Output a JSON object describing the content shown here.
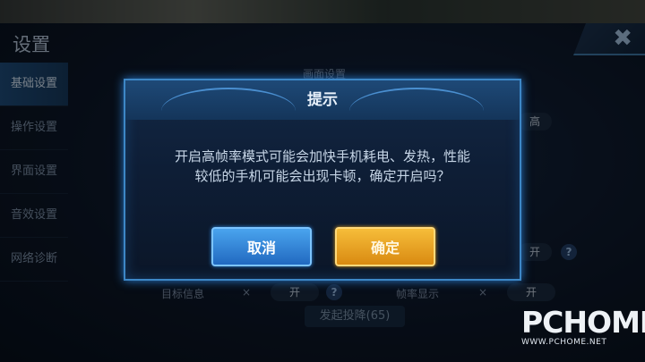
{
  "page": {
    "title": "设置"
  },
  "sidebar": {
    "items": [
      {
        "label": "基础设置",
        "active": true
      },
      {
        "label": "操作设置"
      },
      {
        "label": "界面设置"
      },
      {
        "label": "音效设置"
      },
      {
        "label": "网络诊断"
      }
    ]
  },
  "background": {
    "section_heading": "画面设置",
    "quality_value": "高",
    "toggle_on": "开",
    "toggle_off": "×",
    "help": "?",
    "target_info_label": "目标信息",
    "framerate_label": "帧率显示",
    "report_button": "发起投降(65)"
  },
  "dialog": {
    "title": "提示",
    "message_line1": "开启高帧率模式可能会加快手机耗电、发热，性能",
    "message_line2": "较低的手机可能会出现卡顿，确定开启吗？",
    "cancel_label": "取消",
    "confirm_label": "确定"
  },
  "watermark": {
    "logo": "PCHOME",
    "url": "WWW.PCHOME.NET"
  },
  "colors": {
    "dialog_border": "#3d87c6",
    "cancel_button": "#2f8ae0",
    "confirm_button": "#e0a020"
  }
}
